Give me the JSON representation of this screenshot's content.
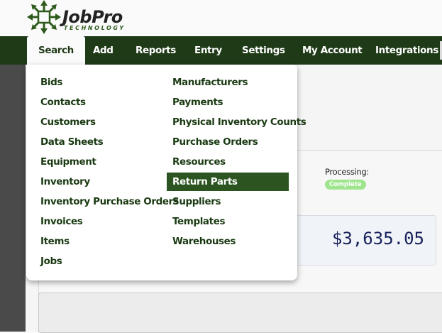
{
  "logo": {
    "name": "JobPro",
    "tagline": "TECHNOLOGY"
  },
  "nav": [
    {
      "label": "Search"
    },
    {
      "label": "Add"
    },
    {
      "label": "Reports"
    },
    {
      "label": "Entry"
    },
    {
      "label": "Settings"
    },
    {
      "label": "My Account"
    },
    {
      "label": "Integrations"
    }
  ],
  "search_menu": {
    "left": [
      "Bids",
      "Contacts",
      "Customers",
      "Data Sheets",
      "Equipment",
      "Inventory",
      "Inventory Purchase Orders",
      "Invoices",
      "Items",
      "Jobs"
    ],
    "right": [
      "Manufacturers",
      "Payments",
      "Physical Inventory Counts",
      "Purchase Orders",
      "Resources",
      "Return Parts",
      "Suppliers",
      "Templates",
      "Warehouses"
    ],
    "highlighted": "Return Parts"
  },
  "processing": {
    "label": "Processing:",
    "status": "Complete"
  },
  "amount": "$3,635.05",
  "colors": {
    "nav_bg": "#1f3a17",
    "highlight": "#2b5420",
    "badge": "#9fe58d"
  }
}
